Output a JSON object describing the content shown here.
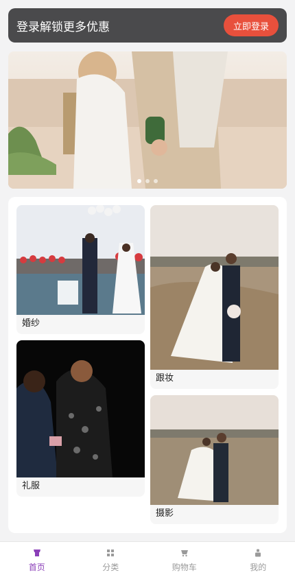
{
  "login_banner": {
    "text": "登录解锁更多优惠",
    "button": "立即登录"
  },
  "carousel": {
    "slide_count": 3,
    "active_index": 0
  },
  "categories": [
    {
      "label": "婚纱"
    },
    {
      "label": "跟妆"
    },
    {
      "label": "礼服"
    },
    {
      "label": "摄影"
    }
  ],
  "tabbar": [
    {
      "label": "首页",
      "icon": "shirt-icon",
      "active": true
    },
    {
      "label": "分类",
      "icon": "grid-icon",
      "active": false
    },
    {
      "label": "购物车",
      "icon": "cart-icon",
      "active": false
    },
    {
      "label": "我的",
      "icon": "user-icon",
      "active": false
    }
  ],
  "colors": {
    "accent": "#8b3fb8",
    "login_button": "#e8503c",
    "banner_bg": "#4a4a4c"
  }
}
